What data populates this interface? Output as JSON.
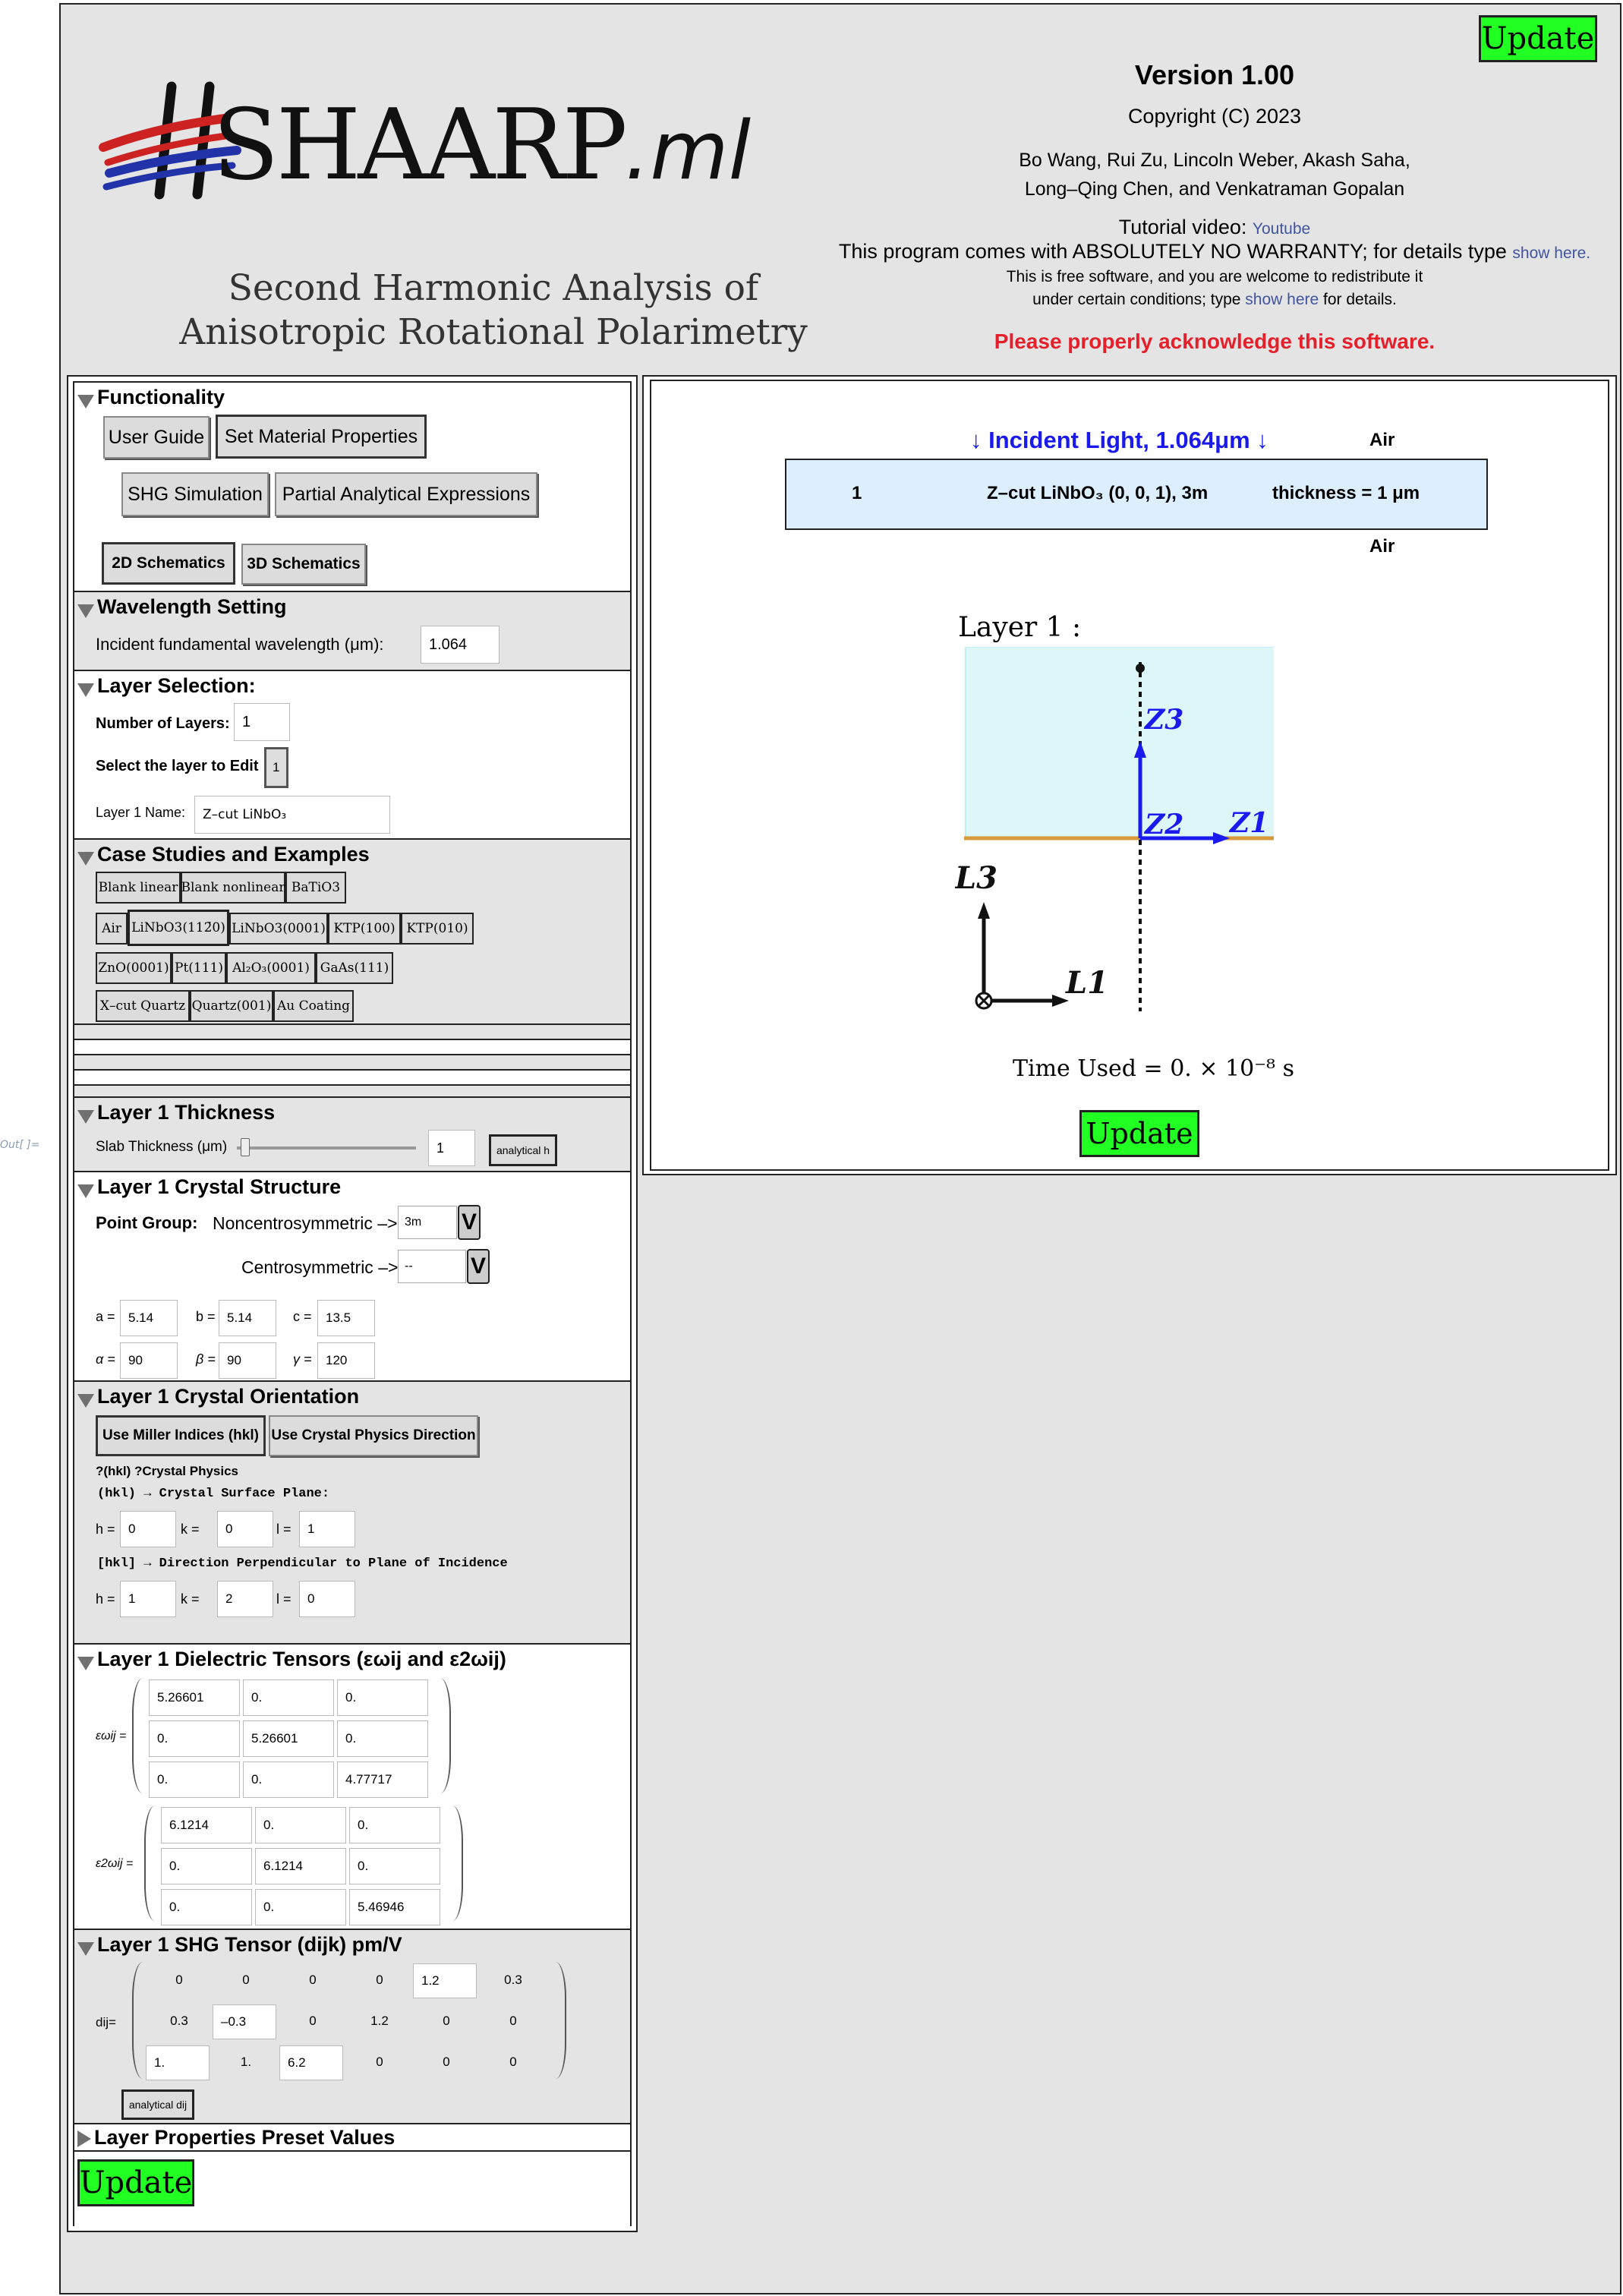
{
  "out_label": "Out[ ]=",
  "header": {
    "update_label": "Update",
    "logo_main": "SHAARP",
    "logo_suffix": ".ml",
    "subtitle_line1": "Second Harmonic Analysis of",
    "subtitle_line2": "Anisotropic Rotational Polarimetry",
    "version": "Version 1.00",
    "copyright": "Copyright (C) 2023",
    "authors_line1": "Bo Wang, Rui Zu, Lincoln Weber, Akash Saha,",
    "authors_line2": "Long–Qing Chen, and Venkatraman Gopalan",
    "tutorial_text": "Tutorial video:",
    "tutorial_link": "Youtube",
    "warranty_text": "This program comes with ABSOLUTELY NO WARRANTY; for details type",
    "warranty_link": "show here.",
    "free_line1": "This is free software, and you are welcome to redistribute it",
    "free_line2_pre": "under certain conditions; type",
    "free_line2_link": "show here",
    "free_line2_post": "for details.",
    "acknowledge": "Please properly acknowledge this software."
  },
  "functionality": {
    "heading": "Functionality",
    "buttons": [
      "User Guide",
      "Set Material Properties",
      "SHG Simulation",
      "Partial Analytical Expressions"
    ],
    "schematics": [
      "2D Schematics",
      "3D Schematics"
    ]
  },
  "wavelength": {
    "heading": "Wavelength Setting",
    "label": "Incident fundamental wavelength (μm):",
    "value": "1.064"
  },
  "layer_selection": {
    "heading": "Layer Selection:",
    "num_layers_label": "Number of Layers:",
    "num_layers": "1",
    "edit_label": "Select the layer to Edit :",
    "edit_value": "1",
    "name_label": "Layer 1 Name:",
    "name_value": "Z–cut LiNbO₃"
  },
  "cases": {
    "heading": "Case Studies and Examples",
    "row1": [
      "Blank linear",
      "Blank nonlinear",
      "BaTiO3"
    ],
    "row2": [
      "Air",
      "LiNbO3(112̄0)",
      "LiNbO3(0001)",
      "KTP(100)",
      "KTP(010)"
    ],
    "row3": [
      "ZnO(0001)",
      "Pt(111)",
      "Al₂O₃(0001)",
      "GaAs(111)"
    ],
    "row4": [
      "X–cut Quartz",
      "Quartz(001)",
      "Au Coating"
    ]
  },
  "thickness": {
    "heading": "Layer 1 Thickness",
    "label": "Slab Thickness (μm)",
    "slider_fraction": 0.02,
    "value": "1",
    "button": "analytical h"
  },
  "crystal_structure": {
    "heading": "Layer 1 Crystal Structure",
    "point_group_label": "Point Group:",
    "noncentro_label": "Noncentrosymmetric –>",
    "noncentro_value": "3m",
    "centro_label": "Centrosymmetric –>",
    "centro_value": "--",
    "a_label": "a =",
    "a": "5.14",
    "b_label": "b =",
    "b": "5.14",
    "c_label": "c =",
    "c": "13.5",
    "alpha_label": "α =",
    "alpha": "90",
    "beta_label": "β =",
    "beta": "90",
    "gamma_label": "γ =",
    "gamma": "120"
  },
  "orientation": {
    "heading": "Layer 1 Crystal Orientation",
    "btn_miller": "Use Miller Indices (hkl)",
    "btn_physics": "Use Crystal Physics Direction",
    "note": "?(hkl) ?Crystal Physics",
    "plane_label": "(hkl) → Crystal Surface Plane:",
    "h1": "0",
    "k1": "0",
    "l1": "1",
    "dir_label": "[hkl] → Direction Perpendicular to Plane of Incidence",
    "h2": "1",
    "k2": "2",
    "l2": "0",
    "h_label": "h =",
    "k_label": "k =",
    "l_label": "l ="
  },
  "dielectric": {
    "heading": "Layer 1 Dielectric Tensors (εωij and ε2ωij)",
    "eps_w_label": "εωij =",
    "eps_w": [
      [
        "5.26601",
        "0.",
        "0."
      ],
      [
        "0.",
        "5.26601",
        "0."
      ],
      [
        "0.",
        "0.",
        "4.77717"
      ]
    ],
    "eps_2w_label": "ε2ωij =",
    "eps_2w": [
      [
        "6.1214",
        "0.",
        "0."
      ],
      [
        "0.",
        "6.1214",
        "0."
      ],
      [
        "0.",
        "0.",
        "5.46946"
      ]
    ]
  },
  "shg": {
    "heading": "Layer 1 SHG Tensor (dijk) pm/V",
    "label": "dij=",
    "d": [
      [
        "0",
        "0",
        "0",
        "0",
        "1.2",
        "0.3"
      ],
      [
        "0.3",
        "–0.3",
        "0",
        "1.2",
        "0",
        "0"
      ],
      [
        "1.",
        "1.",
        "6.2",
        "0",
        "0",
        "0"
      ]
    ],
    "button": "analytical dij"
  },
  "presets": {
    "heading": "Layer Properties Preset Values"
  },
  "schematic": {
    "incident": "↓ Incident Light, 1.064μm ↓",
    "air_top": "Air",
    "air_bottom": "Air",
    "layer_index": "1",
    "layer_material": "Z–cut LiNbO₃  (0, 0, 1),  3m",
    "layer_thickness": "thickness = 1 μm",
    "layer_title": "Layer 1 :",
    "z3": "Z3",
    "z2": "Z2",
    "z1": "Z1",
    "l3": "L3",
    "l1": "L1",
    "time_used": "Time Used = 0. × 10⁻⁸ s",
    "colors": {
      "incident": "#1a1aee",
      "layer_fill": "#ddeeff",
      "crystal_fill": "#ddf7f9",
      "surface": "#d89a3a",
      "update_green": "#22ff22"
    }
  }
}
